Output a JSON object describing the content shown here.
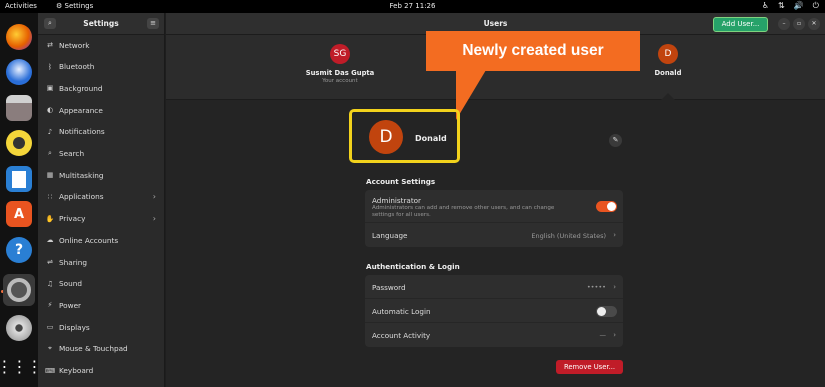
{
  "topbar": {
    "activities": "Activities",
    "app_name": "Settings",
    "clock": "Feb 27  11:26"
  },
  "dock": {
    "apps": [
      "firefox",
      "thunderbird",
      "files",
      "rhythmbox",
      "writer",
      "app-center",
      "help",
      "settings",
      "dvd",
      "show-apps"
    ]
  },
  "sidebar": {
    "title": "Settings",
    "items": [
      {
        "label": "Network",
        "icon": "network-icon"
      },
      {
        "label": "Bluetooth",
        "icon": "bluetooth-icon"
      },
      {
        "label": "Background",
        "icon": "background-icon"
      },
      {
        "label": "Appearance",
        "icon": "appearance-icon"
      },
      {
        "label": "Notifications",
        "icon": "bell-icon"
      },
      {
        "label": "Search",
        "icon": "search-icon"
      },
      {
        "label": "Multitasking",
        "icon": "multitasking-icon"
      },
      {
        "label": "Applications",
        "icon": "applications-icon",
        "chevron": "›"
      },
      {
        "label": "Privacy",
        "icon": "privacy-icon",
        "chevron": "›"
      },
      {
        "label": "Online Accounts",
        "icon": "online-accounts-icon"
      },
      {
        "label": "Sharing",
        "icon": "sharing-icon"
      },
      {
        "label": "Sound",
        "icon": "sound-icon"
      },
      {
        "label": "Power",
        "icon": "power-icon"
      },
      {
        "label": "Displays",
        "icon": "displays-icon"
      },
      {
        "label": "Mouse & Touchpad",
        "icon": "mouse-icon"
      },
      {
        "label": "Keyboard",
        "icon": "keyboard-icon"
      }
    ]
  },
  "header": {
    "title": "Users",
    "add_user_label": "Add User..."
  },
  "users": [
    {
      "initials": "SG",
      "name": "Susmit Das Gupta",
      "subtitle": "Your account",
      "color": "#c01c28"
    },
    {
      "initials": "D",
      "name": "Donald",
      "subtitle": "",
      "color": "#c1440e"
    }
  ],
  "callout": {
    "text": "Newly created user",
    "color": "#f36c21"
  },
  "profile": {
    "initial": "D",
    "name": "Donald"
  },
  "account_settings": {
    "title": "Account Settings",
    "administrator": {
      "label": "Administrator",
      "description": "Administrators can add and remove other users, and can change settings for all users.",
      "on": true
    },
    "language": {
      "label": "Language",
      "value": "English (United States)"
    }
  },
  "auth": {
    "title": "Authentication & Login",
    "password": {
      "label": "Password",
      "value": "•••••"
    },
    "auto_login": {
      "label": "Automatic Login",
      "on": false
    },
    "activity": {
      "label": "Account Activity",
      "value": "—"
    }
  },
  "remove_user_label": "Remove User...",
  "colors": {
    "accent": "#e95420",
    "add_button": "#26a269",
    "remove_button": "#c01c28",
    "highlight": "#f2d21c"
  }
}
